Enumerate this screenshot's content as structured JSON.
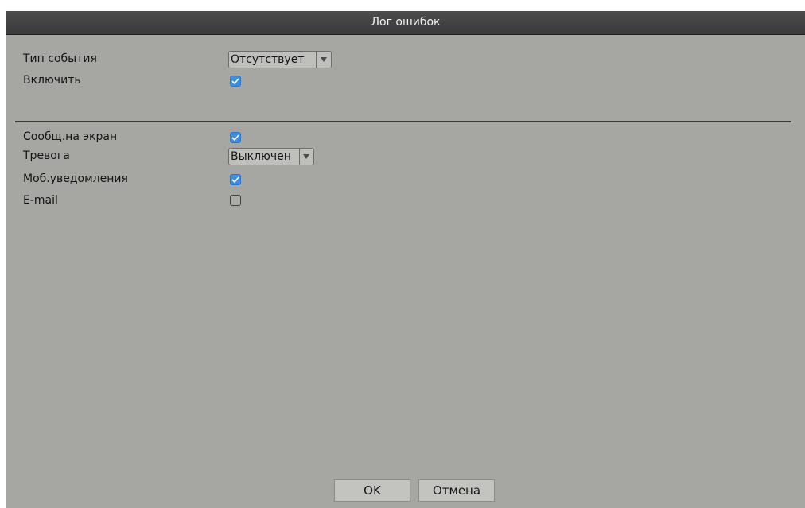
{
  "dialog": {
    "title": "Лог ошибок"
  },
  "fields": {
    "event_type": {
      "label": "Тип события",
      "value": "Отсутствует"
    },
    "enable": {
      "label": "Включить",
      "checked": true
    },
    "screen_msg": {
      "label": "Сообщ.на экран",
      "checked": true
    },
    "alarm": {
      "label": "Тревога",
      "value": "Выключен"
    },
    "mobile_notify": {
      "label": "Моб.уведомления",
      "checked": true
    },
    "email": {
      "label": "E-mail",
      "checked": false
    }
  },
  "buttons": {
    "ok": "OK",
    "cancel": "Отмена"
  },
  "icons": {
    "dropdown": "chevron-down-icon",
    "check": "checkmark-icon"
  },
  "colors": {
    "dialog_bg": "#a6a6a3",
    "titlebar_bg": "#3a3a3a",
    "checkbox_on": "#3d8de0"
  }
}
